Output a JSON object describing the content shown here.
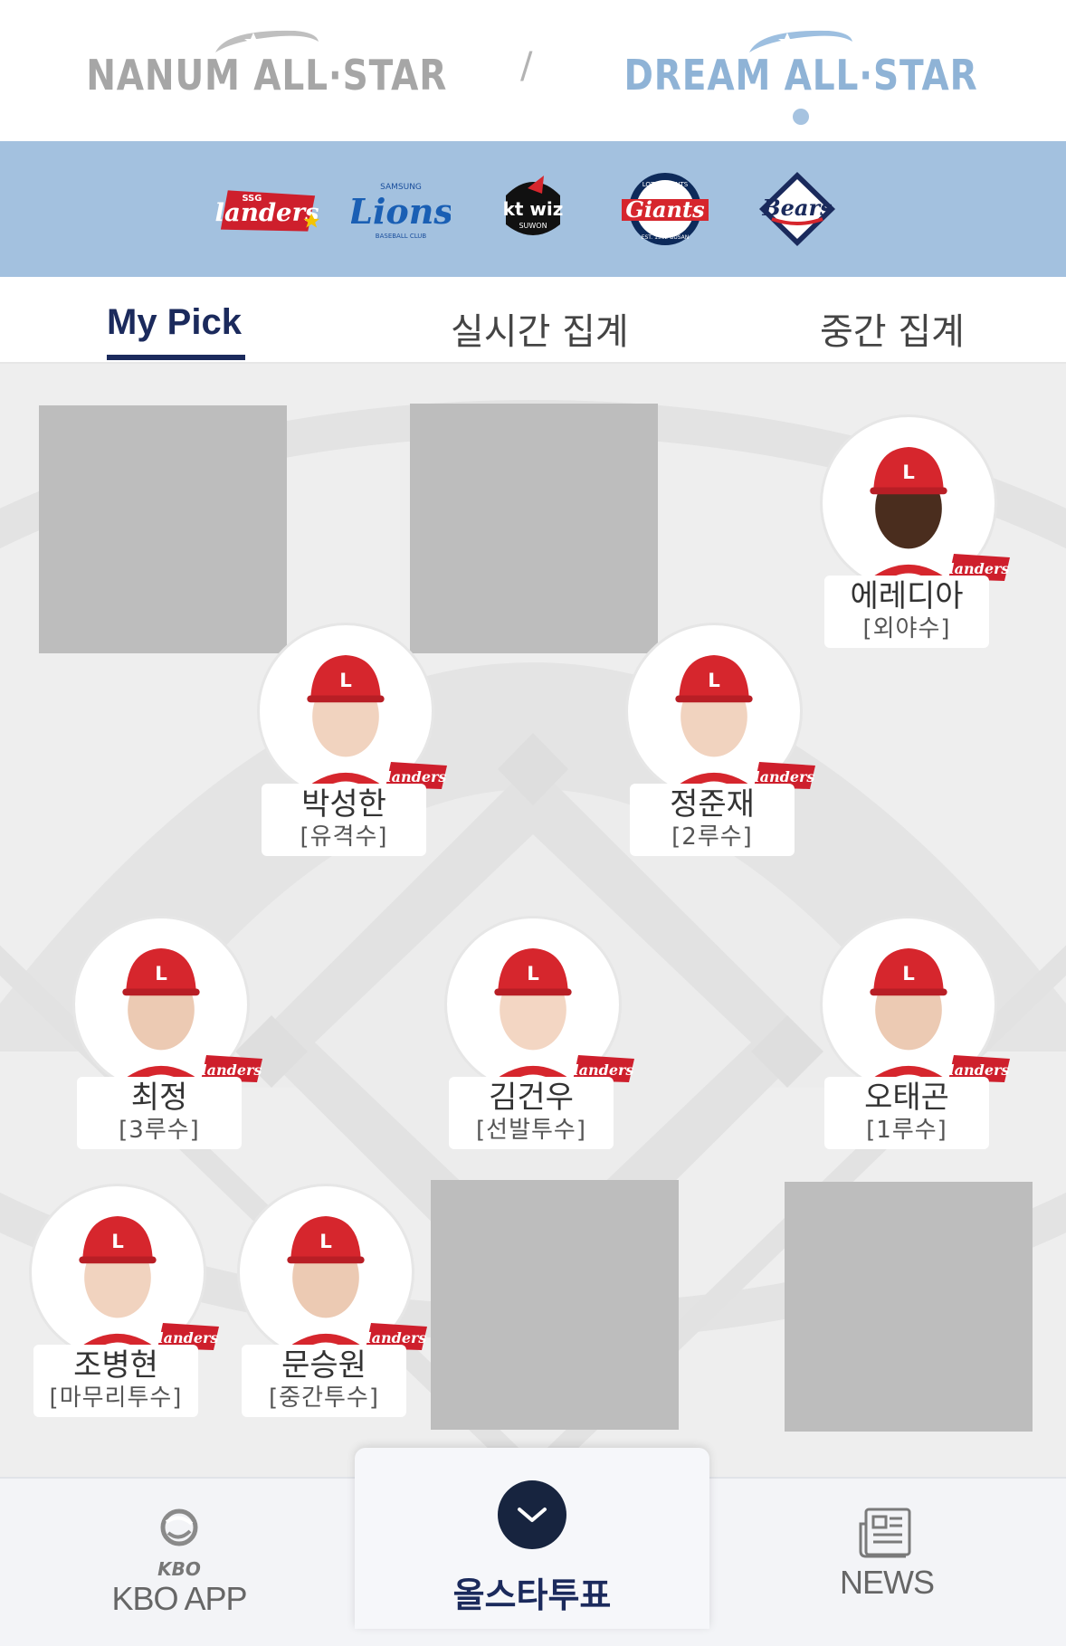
{
  "header": {
    "nanum_title": "NANUM ALL·STAR",
    "dream_title": "DREAM ALL·STAR",
    "separator": "/"
  },
  "teams": [
    {
      "name": "SSG Landers",
      "icon": "landers-logo"
    },
    {
      "name": "Samsung Lions",
      "icon": "lions-logo"
    },
    {
      "name": "kt wiz",
      "icon": "ktwiz-logo"
    },
    {
      "name": "Lotte Giants",
      "icon": "giants-logo"
    },
    {
      "name": "Doosan Bears",
      "icon": "bears-logo"
    }
  ],
  "tabs": [
    {
      "label": "My Pick",
      "active": true
    },
    {
      "label": "실시간 집계",
      "active": false
    },
    {
      "label": "중간 집계",
      "active": false
    }
  ],
  "players": [
    {
      "name": "에레디아",
      "position": "[외야수]"
    },
    {
      "name": "박성한",
      "position": "[유격수]"
    },
    {
      "name": "정준재",
      "position": "[2루수]"
    },
    {
      "name": "최정",
      "position": "[3루수]"
    },
    {
      "name": "김건우",
      "position": "[선발투수]"
    },
    {
      "name": "오태곤",
      "position": "[1루수]"
    },
    {
      "name": "조병현",
      "position": "[마무리투수]"
    },
    {
      "name": "문승원",
      "position": "[중간투수]"
    }
  ],
  "colors": {
    "navy": "#1b2a5c",
    "band": "#a3c1df",
    "cap_red": "#d6262d"
  },
  "bottom_nav": {
    "kbo_app_label": "KBO APP",
    "kbo_logo_text": "KBO",
    "vote_label": "올스타투표",
    "news_label": "NEWS"
  }
}
